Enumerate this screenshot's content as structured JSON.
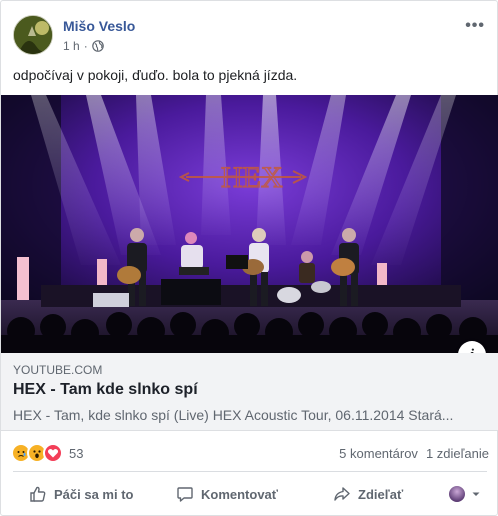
{
  "post": {
    "author": "Mišo Veslo",
    "time": "1 h",
    "privacy_icon": "globe-icon",
    "text": "odpočívaj v pokoji, ďuďo. bola to pjekná jízda."
  },
  "media": {
    "stage_sign": "HEX",
    "info_label": "i"
  },
  "link": {
    "domain": "YOUTUBE.COM",
    "title": "HEX - Tam kde slnko spí",
    "description": "HEX - Tam, kde slnko spí (Live) HEX Acoustic Tour, 06.11.2014 Stará..."
  },
  "stats": {
    "reaction_icons": [
      "sad-icon",
      "wow-icon",
      "love-icon"
    ],
    "reaction_count": "53",
    "comments": "5 komentárov",
    "shares": "1 zdieľanie"
  },
  "actions": {
    "like": "Páči sa mi to",
    "comment": "Komentovať",
    "share": "Zdieľať"
  },
  "colors": {
    "author_link": "#385898",
    "secondary_text": "#606770",
    "link_box_bg": "#f2f3f5",
    "stage_purple": "#5a1fb0"
  }
}
